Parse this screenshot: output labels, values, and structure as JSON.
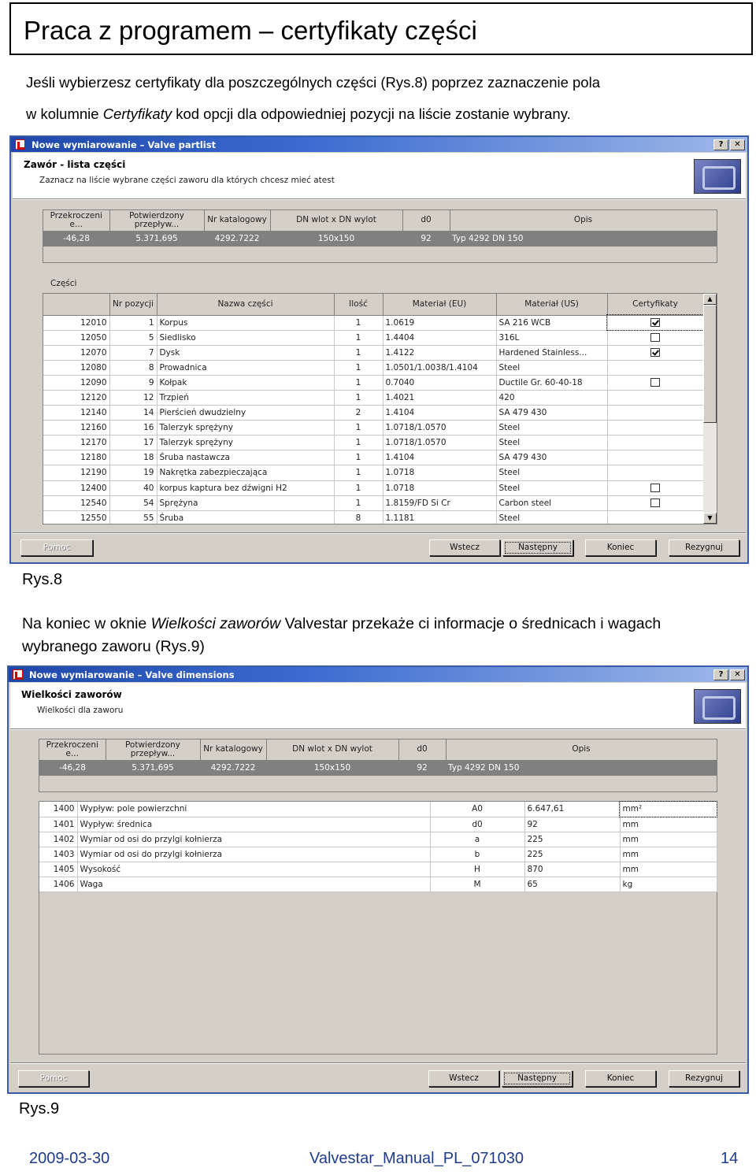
{
  "page": {
    "title": "Praca z programem – certyfikaty części",
    "para1_line1": "Jeśli wybierzesz certyfikaty dla poszczególnych części (Rys.8) poprzez zaznaczenie pola",
    "para1_line2_a": "w kolumnie ",
    "para1_line2_em": "Certyfikaty",
    "para1_line2_b": "  kod opcji dla odpowiedniej pozycji na liście zostanie wybrany.",
    "caption1": "Rys.8",
    "para2_line1_a": "Na koniec w oknie ",
    "para2_line1_em": "Wielkości zaworów",
    "para2_line1_b": " Valvestar przekaże ci informacje o średnicach i wagach",
    "para2_line2": "wybranego zaworu (Rys.9)",
    "caption2": "Rys.9"
  },
  "window1": {
    "title": "Nowe wymiarowanie – Valve partlist",
    "help_btn": "?",
    "close_btn": "✕",
    "header_title": "Zawór - lista części",
    "header_sub": "Zaznacz na liście wybrane części zaworu dla których chcesz mieć atest",
    "summary_headers": [
      "Przekroczeni e...",
      "Potwierdzony przepływ...",
      "Nr katalogowy",
      "DN wlot x DN wylot",
      "d0",
      "Opis"
    ],
    "summary_values": [
      "-46,28",
      "5.371,695",
      "4292.7222",
      "150x150",
      "92",
      "Typ 4292 DN 150"
    ],
    "parts_label": "Części",
    "parts_headers": [
      "",
      "Nr pozycji",
      "Nazwa części",
      "Ilość",
      "Materiał (EU)",
      "Materiał (US)",
      "Certyfikaty"
    ],
    "parts": [
      {
        "id": "12010",
        "pos": "1",
        "name": "Korpus",
        "qty": "1",
        "eu": "1.0619",
        "us": "SA 216 WCB",
        "cert": "checked"
      },
      {
        "id": "12050",
        "pos": "5",
        "name": "Siedlisko",
        "qty": "1",
        "eu": "1.4404",
        "us": "316L",
        "cert": "unchecked"
      },
      {
        "id": "12070",
        "pos": "7",
        "name": "Dysk",
        "qty": "1",
        "eu": "1.4122",
        "us": "Hardened Stainless...",
        "cert": "checked"
      },
      {
        "id": "12080",
        "pos": "8",
        "name": "Prowadnica",
        "qty": "1",
        "eu": "1.0501/1.0038/1.4104",
        "us": "Steel",
        "cert": ""
      },
      {
        "id": "12090",
        "pos": "9",
        "name": "Kołpak",
        "qty": "1",
        "eu": "0.7040",
        "us": "Ductile Gr. 60-40-18",
        "cert": "unchecked"
      },
      {
        "id": "12120",
        "pos": "12",
        "name": "Trzpień",
        "qty": "1",
        "eu": "1.4021",
        "us": "420",
        "cert": ""
      },
      {
        "id": "12140",
        "pos": "14",
        "name": "Pierścień dwudzielny",
        "qty": "2",
        "eu": "1.4104",
        "us": "SA 479 430",
        "cert": ""
      },
      {
        "id": "12160",
        "pos": "16",
        "name": "Talerzyk sprężyny",
        "qty": "1",
        "eu": "1.0718/1.0570",
        "us": "Steel",
        "cert": ""
      },
      {
        "id": "12170",
        "pos": "17",
        "name": "Talerzyk sprężyny",
        "qty": "1",
        "eu": "1.0718/1.0570",
        "us": "Steel",
        "cert": ""
      },
      {
        "id": "12180",
        "pos": "18",
        "name": "Śruba nastawcza",
        "qty": "1",
        "eu": "1.4104",
        "us": "SA 479 430",
        "cert": ""
      },
      {
        "id": "12190",
        "pos": "19",
        "name": "Nakrętka zabezpieczająca",
        "qty": "1",
        "eu": "1.0718",
        "us": "Steel",
        "cert": ""
      },
      {
        "id": "12400",
        "pos": "40",
        "name": "korpus kaptura bez dźwigni H2",
        "qty": "1",
        "eu": "1.0718",
        "us": "Steel",
        "cert": "unchecked"
      },
      {
        "id": "12540",
        "pos": "54",
        "name": "Sprężyna",
        "qty": "1",
        "eu": "1.8159/FD Si Cr",
        "us": "Carbon steel",
        "cert": "unchecked"
      },
      {
        "id": "12550",
        "pos": "55",
        "name": "Śruba",
        "qty": "8",
        "eu": "1.1181",
        "us": "Steel",
        "cert": ""
      }
    ],
    "buttons": {
      "help": "Pomoc",
      "back": "Wstecz",
      "next": "Następny",
      "finish": "Koniec",
      "cancel": "Rezygnuj"
    }
  },
  "window2": {
    "title": "Nowe wymiarowanie – Valve dimensions",
    "help_btn": "?",
    "close_btn": "✕",
    "header_title": "Wielkości zaworów",
    "header_sub": "Wielkości dla zaworu",
    "summary_headers": [
      "Przekroczeni e...",
      "Potwierdzony przepływ...",
      "Nr katalogowy",
      "DN wlot x DN wylot",
      "d0",
      "Opis"
    ],
    "summary_values": [
      "-46,28",
      "5.371,695",
      "4292.7222",
      "150x150",
      "92",
      "Typ 4292 DN 150"
    ],
    "dims": [
      {
        "id": "1400",
        "name": "Wypływ: pole powierzchni",
        "sym": "A0",
        "val": "6.647,61",
        "unit": "mm²"
      },
      {
        "id": "1401",
        "name": "Wypływ: średnica",
        "sym": "d0",
        "val": "92",
        "unit": "mm"
      },
      {
        "id": "1402",
        "name": "Wymiar od osi do przylgi kołnierza",
        "sym": "a",
        "val": "225",
        "unit": "mm"
      },
      {
        "id": "1403",
        "name": "Wymiar od osi do przylgi kołnierza",
        "sym": "b",
        "val": "225",
        "unit": "mm"
      },
      {
        "id": "1405",
        "name": "Wysokość",
        "sym": "H",
        "val": "870",
        "unit": "mm"
      },
      {
        "id": "1406",
        "name": "Waga",
        "sym": "M",
        "val": "65",
        "unit": "kg"
      }
    ],
    "buttons": {
      "help": "Pomoc",
      "back": "Wstecz",
      "next": "Następny",
      "finish": "Koniec",
      "cancel": "Rezygnuj"
    }
  },
  "footer": {
    "date": "2009-03-30",
    "doc": "Valvestar_Manual_PL_071030",
    "page": "14"
  }
}
